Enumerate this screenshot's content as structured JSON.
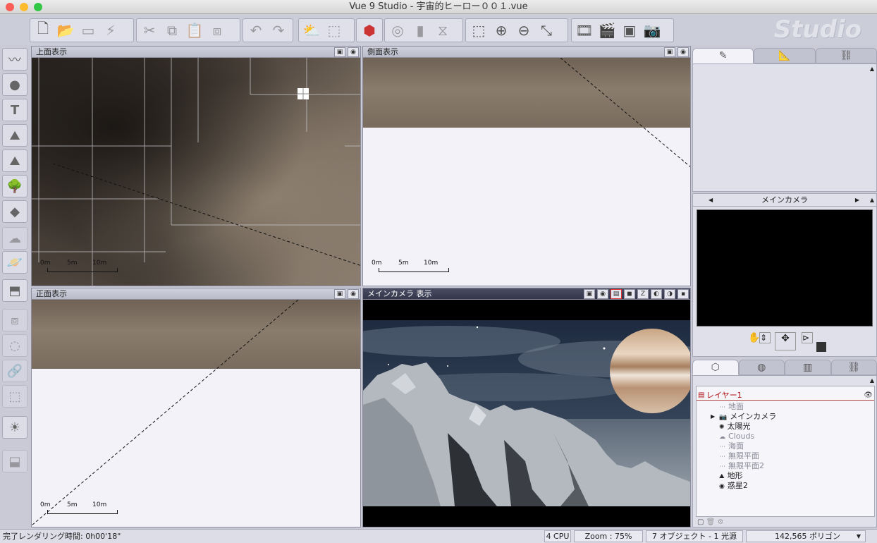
{
  "window": {
    "title": "Vue 9 Studio - 宇宙的ヒーロー００１.vue"
  },
  "brand": {
    "logo": "Studio"
  },
  "viewports": {
    "top": {
      "label": "上面表示",
      "scale": [
        "0m",
        "5m",
        "10m"
      ]
    },
    "side": {
      "label": "側面表示",
      "scale": [
        "0m",
        "5m",
        "10m"
      ]
    },
    "front": {
      "label": "正面表示",
      "scale": [
        "0m",
        "5m",
        "10m"
      ]
    },
    "camera": {
      "label": "メインカメラ 表示",
      "toggle_z": "Z"
    }
  },
  "right_panel": {
    "camera_selector": "メインカメラ",
    "layer_name": "レイヤー1",
    "objects": [
      {
        "name": "地面",
        "icon": "plane-icon",
        "dim": true
      },
      {
        "name": "メインカメラ",
        "icon": "camera-icon",
        "dim": false
      },
      {
        "name": "太陽光",
        "icon": "sun-icon",
        "dim": false
      },
      {
        "name": "Clouds",
        "icon": "cloud-icon",
        "dim": true
      },
      {
        "name": "海面",
        "icon": "plane-icon",
        "dim": true
      },
      {
        "name": "無限平面",
        "icon": "plane-icon",
        "dim": true
      },
      {
        "name": "無限平面2",
        "icon": "plane-icon",
        "dim": true
      },
      {
        "name": "地形",
        "icon": "terrain-icon",
        "dim": false
      },
      {
        "name": "惑星2",
        "icon": "planet-icon",
        "dim": false
      }
    ]
  },
  "status": {
    "render_time": "完了レンダリング時間: 0h00'18\"",
    "cpu": "4 CPU",
    "zoom": "Zoom : 75%",
    "objects": "7 オブジェクト - 1 光源",
    "polygons": "142,565 ポリゴン"
  }
}
